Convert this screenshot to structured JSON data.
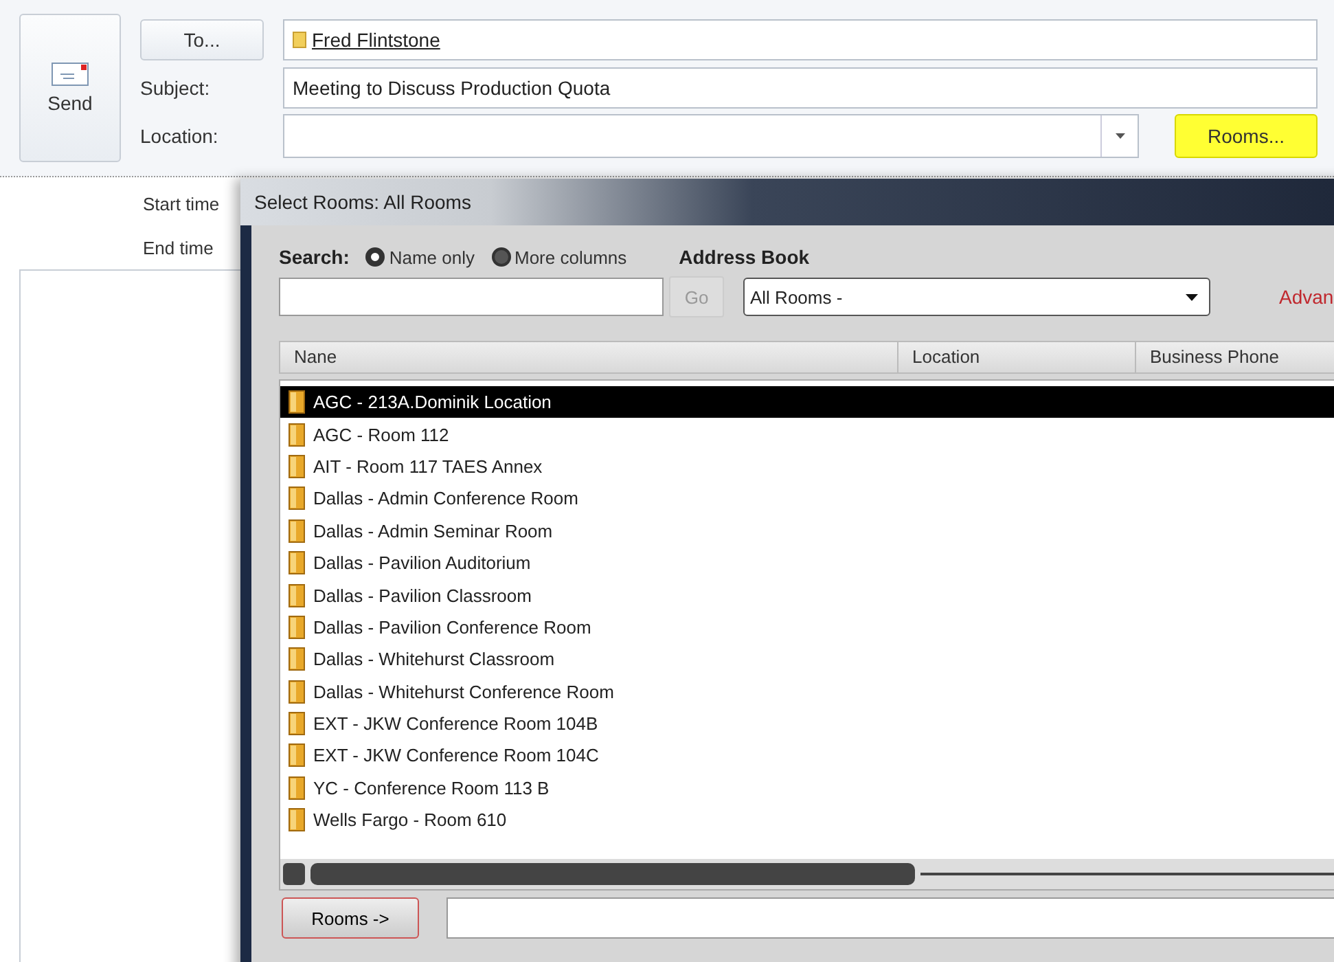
{
  "compose": {
    "send_label": "Send",
    "to_button": "To...",
    "recipient": "Fred Flintstone",
    "subject_label": "Subject:",
    "subject": "Meeting to Discuss Production Quota",
    "location_label": "Location:",
    "rooms_button": "Rooms...",
    "start_label": "Start time",
    "end_label": "End time"
  },
  "dialog": {
    "title": "Select Rooms: All Rooms",
    "search_label": "Search:",
    "search_options": [
      {
        "label": "Name only",
        "selected": true
      },
      {
        "label": "More columns",
        "selected": false
      }
    ],
    "go_button": "Go",
    "address_book_label": "Address Book",
    "address_book": "All Rooms -",
    "advanced_link": "Advan",
    "columns": [
      "Nane",
      "Location",
      "Business Phone"
    ],
    "rows": [
      {
        "name": "AGC - 213A.Dominik Location",
        "selected": true
      },
      {
        "name": "AGC - Room 112",
        "selected": false
      },
      {
        "name": "AIT - Room 117 TAES Annex",
        "selected": false
      },
      {
        "name": "Dallas - Admin Conference Room",
        "selected": false
      },
      {
        "name": "Dallas - Admin Seminar Room",
        "selected": false
      },
      {
        "name": "Dallas - Pavilion Auditorium",
        "selected": false
      },
      {
        "name": "Dallas - Pavilion Classroom",
        "selected": false
      },
      {
        "name": "Dallas - Pavilion Conference Room",
        "selected": false
      },
      {
        "name": "Dallas - Whitehurst Classroom",
        "selected": false
      },
      {
        "name": "Dallas - Whitehurst Conference Room",
        "selected": false
      },
      {
        "name": "EXT - JKW Conference Room 104B",
        "selected": false
      },
      {
        "name": "EXT - JKW Conference Room 104C",
        "selected": false
      },
      {
        "name": "YC - Conference Room 113 B",
        "selected": false
      },
      {
        "name": "Wells Fargo - Room 610",
        "selected": false
      }
    ],
    "rooms_button": "Rooms ->"
  }
}
